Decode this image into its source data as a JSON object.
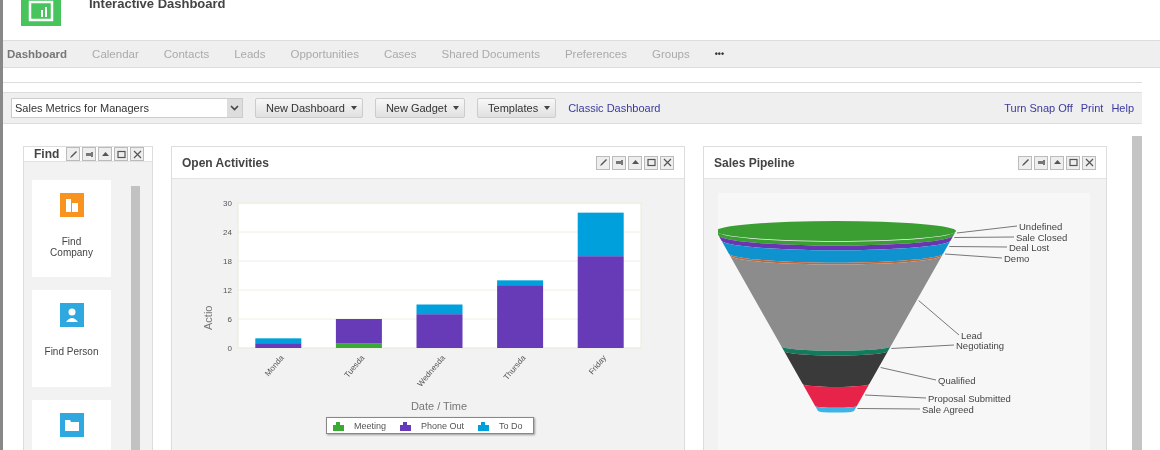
{
  "header": {
    "title": "Interactive Dashboard"
  },
  "nav": [
    {
      "label": "Dashboard",
      "selected": true
    },
    {
      "label": "Calendar",
      "selected": false
    },
    {
      "label": "Contacts",
      "selected": false
    },
    {
      "label": "Leads",
      "selected": false
    },
    {
      "label": "Opportunities",
      "selected": false
    },
    {
      "label": "Cases",
      "selected": false
    },
    {
      "label": "Shared Documents",
      "selected": false
    },
    {
      "label": "Preferences",
      "selected": false
    },
    {
      "label": "Groups",
      "selected": false
    }
  ],
  "nav_more": "•••",
  "toolbar": {
    "dashboard_select": "Sales Metrics for Managers",
    "buttons": [
      "New Dashboard",
      "New Gadget",
      "Templates"
    ],
    "classic_link": "Classic Dashboard",
    "right_links": [
      "Turn Snap Off",
      "Print",
      "Help"
    ]
  },
  "find_panel": {
    "title": "Find",
    "items": [
      {
        "label": "Find Company",
        "color": "#f7931e"
      },
      {
        "label": "Find Person",
        "color": "#2ea8de"
      },
      {
        "color": "#2ea8de"
      }
    ]
  },
  "activities_panel": {
    "title": "Open Activities",
    "chart_data": {
      "type": "bar",
      "stacked": true,
      "xlabel": "Date / Time",
      "ylabel": "Actio",
      "categories": [
        "Monda",
        "Tuesda",
        "Wednesda",
        "Thursda",
        "Friday"
      ],
      "ylim": [
        0,
        30
      ],
      "grid": true,
      "legend": true,
      "yticks": [
        0,
        6,
        12,
        18,
        24,
        30
      ],
      "series": [
        {
          "name": "Meeting",
          "color": "#3aa935",
          "values": [
            0,
            1,
            0,
            0,
            0
          ]
        },
        {
          "name": "Phone Out",
          "color": "#673ab7",
          "values": [
            1,
            5,
            7,
            13,
            19
          ]
        },
        {
          "name": "To Do",
          "color": "#00a0dc",
          "values": [
            1,
            0,
            2,
            1,
            9
          ]
        }
      ]
    }
  },
  "pipeline_panel": {
    "title": "Sales Pipeline",
    "stages": [
      {
        "label": "Undefined",
        "color": "#3a9e32"
      },
      {
        "label": "Sale Closed",
        "color": "#6a35b0"
      },
      {
        "label": "Deal Lost",
        "color": "#0f93cf"
      },
      {
        "label": "Demo",
        "color": "#c0673a"
      },
      {
        "label": "Lead",
        "color": "#8c8c8c"
      },
      {
        "label": "Negotiating",
        "color": "#137a5c"
      },
      {
        "label": "Qualified",
        "color": "#3a3a3a"
      },
      {
        "label": "Proposal Submitted",
        "color": "#e8234a"
      },
      {
        "label": "Sale Agreed",
        "color": "#3cb4e6"
      }
    ]
  }
}
